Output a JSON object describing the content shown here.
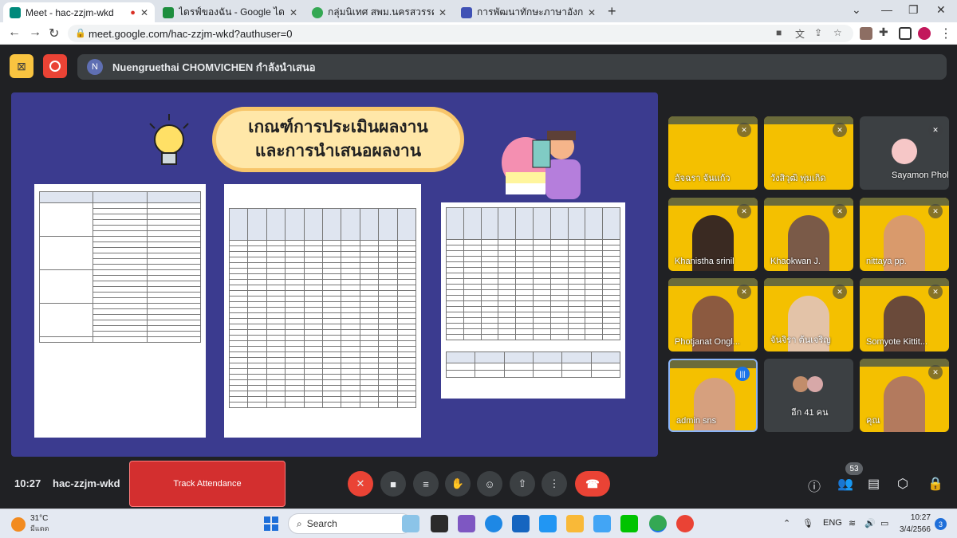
{
  "browser": {
    "tabs": [
      {
        "title": "Meet - hac-zzjm-wkd",
        "color": "#00897b",
        "recording": true
      },
      {
        "title": "ไดรฟ์ของฉัน - Google ไดรฟ์",
        "color": "#1e8e3e"
      },
      {
        "title": "กลุ่มนิเทศ สพม.นครสวรรค์",
        "color": "#34a853"
      },
      {
        "title": "การพัฒนาทักษะภาษาอังกฤษ English",
        "color": "#3f51b5"
      }
    ],
    "new_tab": "+",
    "url": "meet.google.com/hac-zzjm-wkd?authuser=0"
  },
  "meet": {
    "presenter_initial": "N",
    "presenter_text": "Nuengruethai CHOMVICHEN กำลังนำเสนอ",
    "slide": {
      "title_line1": "เกณฑ์การประเมินผลงาน",
      "title_line2": "และการนำเสนอผลงาน"
    },
    "participants": [
      {
        "name": "อัจฉรา จันแก้ว",
        "tile": "yellow"
      },
      {
        "name": "วังสิวุฒิ พุ่มเกิด",
        "tile": "yellow"
      },
      {
        "name": "Sayamon Phol...",
        "tile": "dark"
      },
      {
        "name": "Khanistha srinil",
        "tile": "yellow"
      },
      {
        "name": "Khaokwan J.",
        "tile": "yellow"
      },
      {
        "name": "nittaya pp.",
        "tile": "yellow"
      },
      {
        "name": "Photjanat Ongl...",
        "tile": "yellow"
      },
      {
        "name": "จันจิรา ต้นเจริญ",
        "tile": "yellow"
      },
      {
        "name": "Somyote Kittit...",
        "tile": "yellow"
      },
      {
        "name": "admin sns",
        "tile": "yellow",
        "speaking": true
      },
      {
        "name": "อีก 41 คน",
        "tile": "dark"
      },
      {
        "name": "คุณ",
        "tile": "yellow"
      }
    ],
    "time": "10:27",
    "meeting_code": "hac-zzjm-wkd",
    "track_attendance": "Track Attendance",
    "people_count": "53"
  },
  "taskbar": {
    "temp": "31°C",
    "weather_desc": "มีแดด",
    "search_placeholder": "Search",
    "lang": "ENG",
    "time": "10:27",
    "date": "3/4/2566",
    "notifications": "3"
  }
}
